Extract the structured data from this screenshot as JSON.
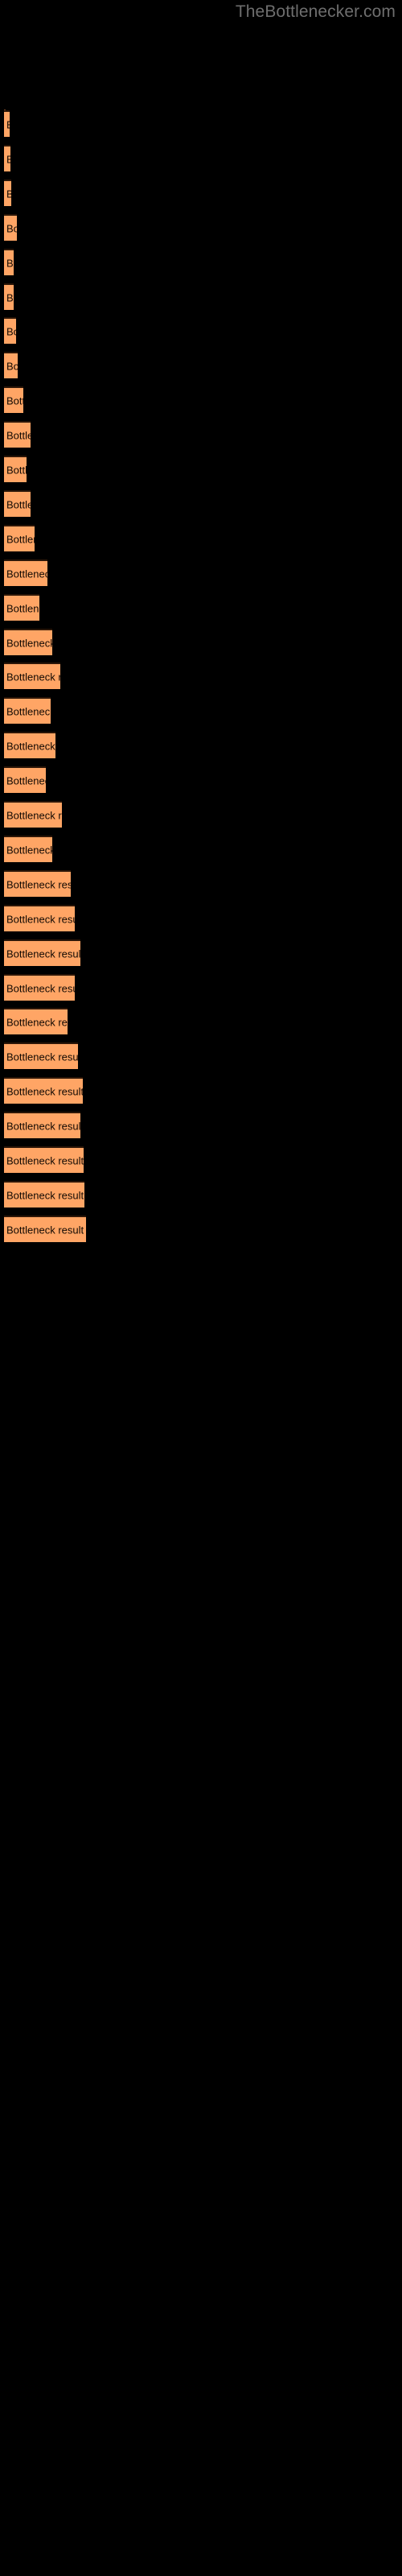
{
  "site": {
    "title": "TheBottlenecker.com"
  },
  "chart_data": {
    "type": "bar",
    "orientation": "horizontal",
    "title": "",
    "subtitle": "",
    "xlabel": "",
    "ylabel": "",
    "background_color": "#000000",
    "bar_color": "#ffa565",
    "bar_edge_color": "#2b1608",
    "label_color": "#120a03",
    "title_color": "#6e6e6e",
    "grid": false,
    "legend": null,
    "axis_visible": false,
    "tick_labels": [],
    "bar_label_text": "Bottleneck result",
    "categories": [
      "Bottleneck result",
      "Bottleneck result",
      "Bottleneck result",
      "Bottleneck result",
      "Bottleneck result",
      "Bottleneck result",
      "Bottleneck result",
      "Bottleneck result",
      "Bottleneck result",
      "Bottleneck result",
      "Bottleneck result",
      "Bottleneck result",
      "Bottleneck result",
      "Bottleneck result",
      "Bottleneck result",
      "Bottleneck result",
      "Bottleneck result",
      "Bottleneck result",
      "Bottleneck result",
      "Bottleneck result",
      "Bottleneck result",
      "Bottleneck result",
      "Bottleneck result",
      "Bottleneck result",
      "Bottleneck result",
      "Bottleneck result",
      "Bottleneck result",
      "Bottleneck result",
      "Bottleneck result",
      "Bottleneck result",
      "Bottleneck result",
      "Bottleneck result",
      "Bottleneck result"
    ],
    "values": [
      7,
      8,
      9,
      16,
      12,
      12,
      15,
      17,
      24,
      33,
      28,
      33,
      72,
      110,
      83,
      120,
      143,
      119,
      130,
      105,
      148,
      122,
      172,
      180,
      196,
      182,
      163,
      191,
      202,
      197,
      205,
      207,
      210
    ],
    "xlim": [
      0,
      225
    ],
    "bar_pixel_widths": [
      7,
      8,
      9,
      16,
      12,
      12,
      15,
      17,
      24,
      33,
      28,
      33,
      38,
      54,
      44,
      60,
      70,
      58,
      64,
      52,
      72,
      60,
      83,
      88,
      95,
      88,
      79,
      92,
      98,
      95,
      99,
      100,
      102
    ]
  }
}
